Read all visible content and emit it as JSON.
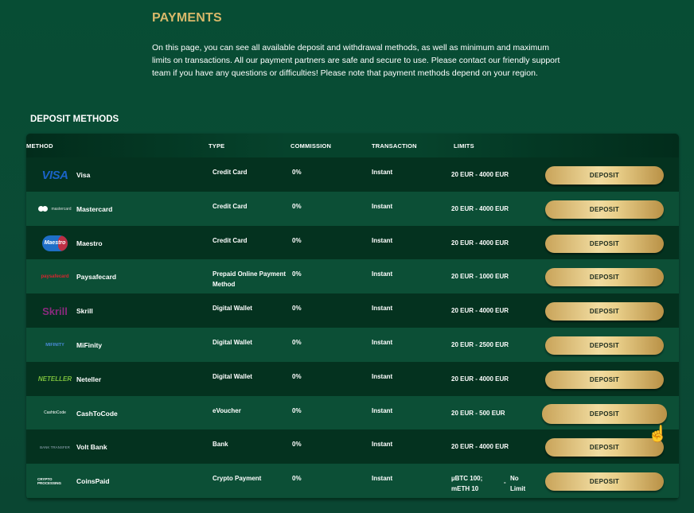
{
  "page": {
    "title": "PAYMENTS",
    "intro": "On this page, you can see all available deposit and withdrawal methods, as well as minimum and maximum limits on transactions. All our payment partners are safe and secure to use. Please contact our friendly support team if you have any questions or difficulties! Please note that payment methods depend on your region.",
    "section_title": "DEPOSIT METHODS"
  },
  "table": {
    "headers": {
      "method": "METHOD",
      "type": "TYPE",
      "commission": "COMMISSION",
      "transaction": "TRANSACTION",
      "limits": "LIMITS"
    },
    "button_label": "DEPOSIT",
    "rows": [
      {
        "name": "Visa",
        "type": "Credit Card",
        "commission": "0%",
        "transaction": "Instant",
        "limits": "20 EUR  -  4000 EUR",
        "logo": "VISA"
      },
      {
        "name": "Mastercard",
        "type": "Credit Card",
        "commission": "0%",
        "transaction": "Instant",
        "limits": "20 EUR  -  4000 EUR",
        "logo": "mastercard"
      },
      {
        "name": "Maestro",
        "type": "Credit Card",
        "commission": "0%",
        "transaction": "Instant",
        "limits": "20 EUR  -  4000 EUR",
        "logo": "Maestro"
      },
      {
        "name": "Paysafecard",
        "type": "Prepaid Online Payment Method",
        "commission": "0%",
        "transaction": "Instant",
        "limits": "20 EUR  -  1000 EUR",
        "logo": "paysafecard"
      },
      {
        "name": "Skrill",
        "type": "Digital Wallet",
        "commission": "0%",
        "transaction": "Instant",
        "limits": "20 EUR  -  4000 EUR",
        "logo": "Skrill"
      },
      {
        "name": "MiFinity",
        "type": "Digital Wallet",
        "commission": "0%",
        "transaction": "Instant",
        "limits": "20 EUR  -  2500 EUR",
        "logo": "MIFINITY"
      },
      {
        "name": "Neteller",
        "type": "Digital Wallet",
        "commission": "0%",
        "transaction": "Instant",
        "limits": "20 EUR  -  4000 EUR",
        "logo": "NETELLER"
      },
      {
        "name": "CashToCode",
        "type": "eVoucher",
        "commission": "0%",
        "transaction": "Instant",
        "limits": "20 EUR  -  500 EUR",
        "logo": "CashtoCode"
      },
      {
        "name": "Volt Bank",
        "type": "Bank",
        "commission": "0%",
        "transaction": "Instant",
        "limits": "20 EUR  -  4000 EUR",
        "logo": "BANK TRANSFER"
      },
      {
        "name": "CoinsPaid",
        "type": "Crypto Payment",
        "commission": "0%",
        "transaction": "Instant",
        "limits": "",
        "limit_min": "µBTC 100; mETH 10",
        "limit_sep": "-",
        "limit_max": "No Limit",
        "logo": "CRYPTO PROCESSING"
      }
    ]
  },
  "colors": {
    "accent_gold": "#d9b86a",
    "background": "#074d34"
  }
}
